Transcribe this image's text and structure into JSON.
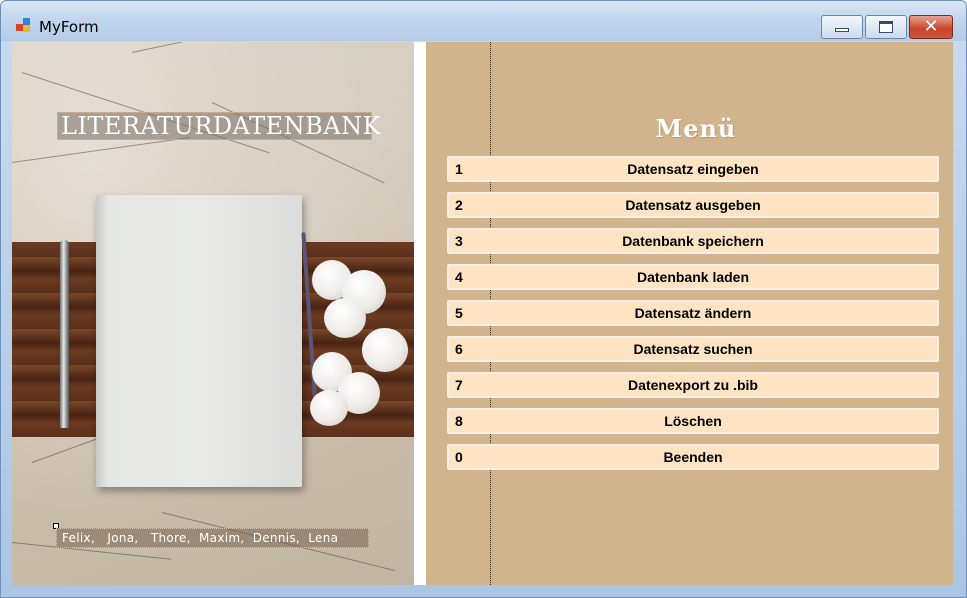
{
  "window": {
    "title": "MyForm",
    "controls": {
      "minimize_icon": "minimize-icon",
      "maximize_icon": "maximize-icon",
      "close_icon": "close-icon",
      "close_glyph": "✕"
    }
  },
  "left_panel": {
    "title": "Literaturdatenbank",
    "authors": "Felix,   Jona,   Thore,  Maxim,  Dennis,  Lena"
  },
  "menu": {
    "title": "Menü",
    "items": [
      {
        "key": "1",
        "label": "Datensatz eingeben"
      },
      {
        "key": "2",
        "label": "Datensatz ausgeben"
      },
      {
        "key": "3",
        "label": "Datenbank speichern"
      },
      {
        "key": "4",
        "label": "Datenbank laden"
      },
      {
        "key": "5",
        "label": "Datensatz ändern"
      },
      {
        "key": "6",
        "label": "Datensatz suchen"
      },
      {
        "key": "7",
        "label": "Datenexport zu .bib"
      },
      {
        "key": "8",
        "label": "Löschen"
      },
      {
        "key": "0",
        "label": "Beenden"
      }
    ]
  },
  "colors": {
    "menu_background": "#d2b48c",
    "button_background": "#ffe4c4",
    "title_color": "#ffffff"
  }
}
